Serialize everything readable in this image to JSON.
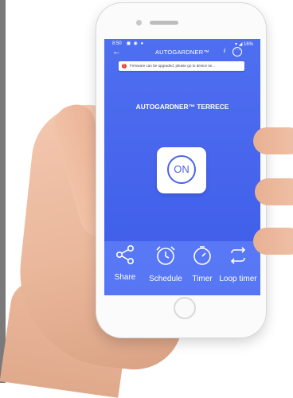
{
  "status_bar": {
    "time": "8:50",
    "left_icons": "◼ ◉ ●",
    "battery": "16%"
  },
  "header": {
    "title": "AUTOGARDNER™",
    "info_symbol": "i",
    "more_symbol": "···"
  },
  "banner": {
    "text": "Firmware can be upgraded, please go to device se..."
  },
  "device": {
    "name": "AUTOGARDNER™ TERRECE"
  },
  "power": {
    "label": "ON"
  },
  "toolbar": {
    "share_label": "Share",
    "schedule_label": "Schedule",
    "timer_label": "Timer",
    "loop_timer_label": "Loop timer"
  },
  "colors": {
    "screen_blue": "#4565ec",
    "accent": "#4b63e5",
    "warning": "#e53935"
  }
}
